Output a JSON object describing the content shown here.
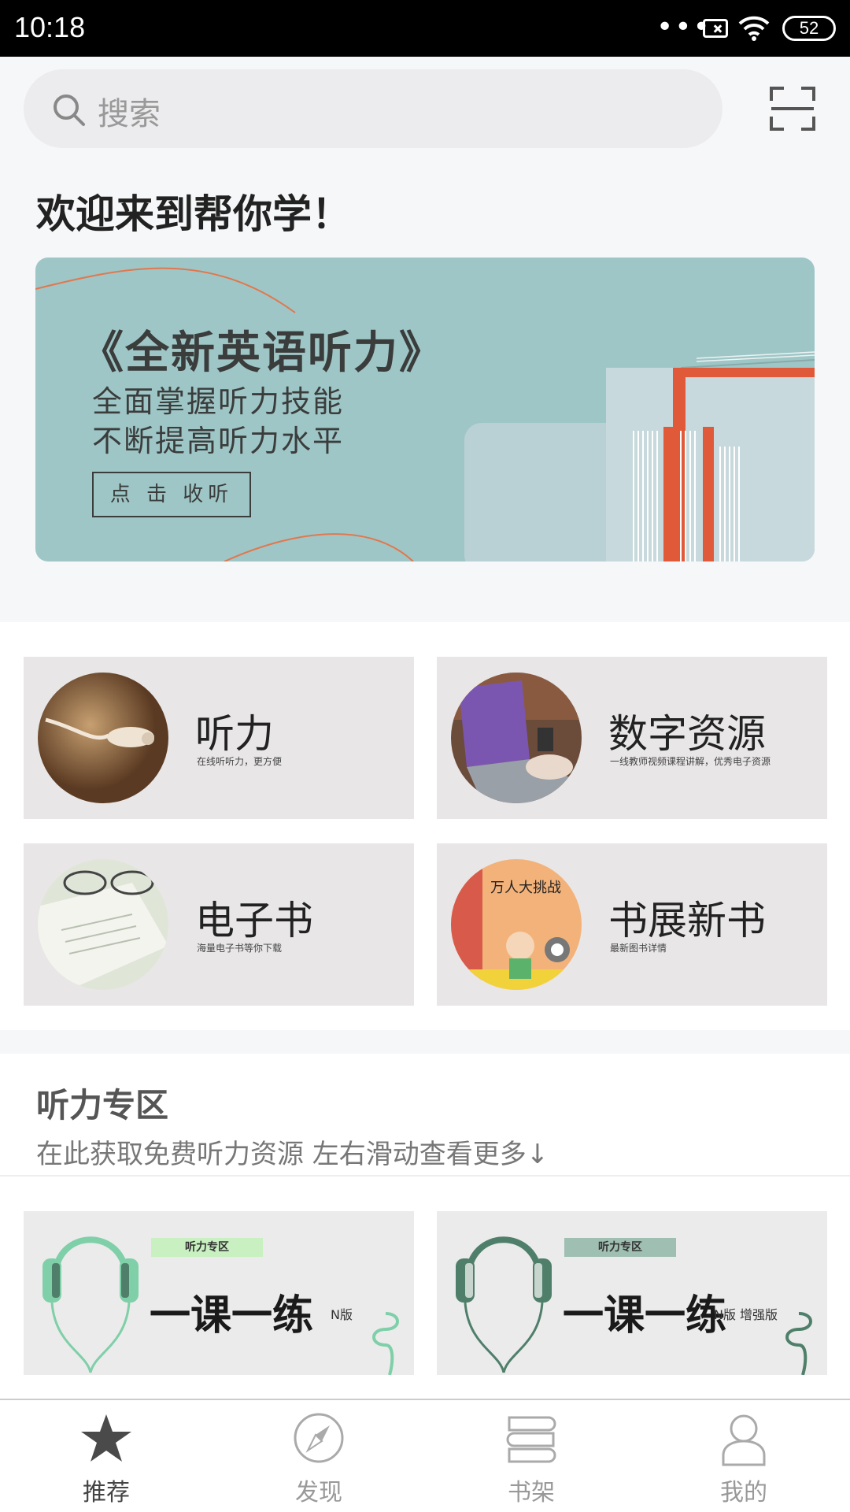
{
  "status_bar": {
    "time": "10:18",
    "signal_dots": "•••",
    "battery": "52"
  },
  "search": {
    "placeholder": "搜索"
  },
  "welcome": "欢迎来到帮你学！",
  "banner": {
    "title": "《全新英语听力》",
    "line1": "全面掌握听力技能",
    "line2": "不断提高听力水平",
    "button": "点 击 收听"
  },
  "categories": [
    {
      "title": "听力",
      "subtitle": "在线听听力，更方便"
    },
    {
      "title": "数字资源",
      "subtitle": "一线教师视频课程讲解，优秀电子资源"
    },
    {
      "title": "电子书",
      "subtitle": "海量电子书等你下载"
    },
    {
      "title": "书展新书",
      "subtitle": "最新图书详情"
    }
  ],
  "book_cover_text": "万人大挑战",
  "listening_zone": {
    "title": "听力专区",
    "subtitle": "在此获取免费听力资源   左右滑动查看更多↓",
    "cards": [
      {
        "tag": "听力专区",
        "title": "一课一练",
        "version": "N版"
      },
      {
        "tag": "听力专区",
        "title": "一课一练",
        "version": "N版 增强版"
      }
    ]
  },
  "bottom_nav": [
    {
      "label": "推荐",
      "icon": "star-icon",
      "active": true
    },
    {
      "label": "发现",
      "icon": "compass-icon",
      "active": false
    },
    {
      "label": "书架",
      "icon": "bookshelf-icon",
      "active": false
    },
    {
      "label": "我的",
      "icon": "person-icon",
      "active": false
    }
  ],
  "colors": {
    "banner_bg": "#9fc6c6",
    "banner_accent": "#e05a3a",
    "card_bg": "#e8e6e6",
    "headphone_light": "#7fcfa8",
    "headphone_dark": "#4f7f6a"
  }
}
